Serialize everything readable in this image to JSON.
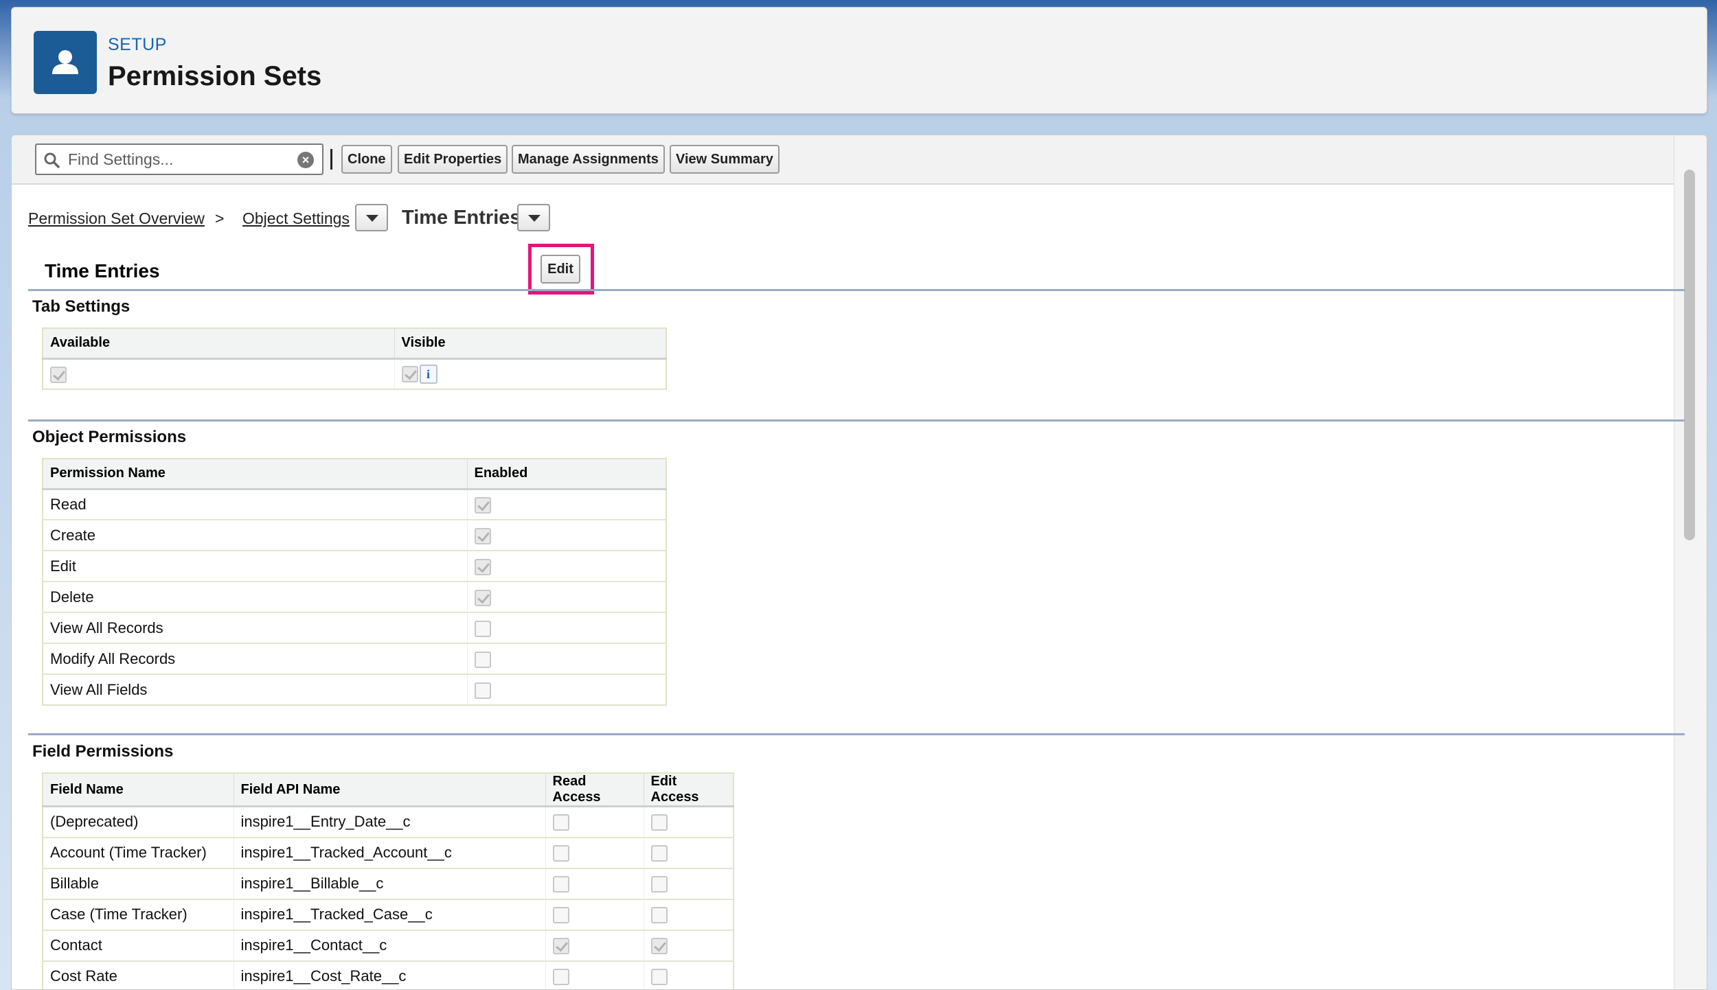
{
  "header": {
    "eyebrow": "SETUP",
    "title": "Permission Sets",
    "icon": "user-icon",
    "icon_color": "#1b5b96"
  },
  "toolbar": {
    "search_placeholder": "Find Settings...",
    "buttons": [
      "Clone",
      "Edit Properties",
      "Manage Assignments",
      "View Summary"
    ]
  },
  "breadcrumb": {
    "overview": "Permission Set Overview",
    "sep": ">",
    "object_settings": "Object Settings",
    "current": "Time Entries"
  },
  "object": {
    "title": "Time Entries",
    "edit_label": "Edit",
    "highlight_color": "#e3157a"
  },
  "tab_settings": {
    "title": "Tab Settings",
    "headers": [
      "Available",
      "Visible"
    ],
    "available": true,
    "visible": true,
    "info_glyph": "i"
  },
  "object_permissions": {
    "title": "Object Permissions",
    "headers": [
      "Permission Name",
      "Enabled"
    ],
    "rows": [
      {
        "name": "Read",
        "enabled": true
      },
      {
        "name": "Create",
        "enabled": true
      },
      {
        "name": "Edit",
        "enabled": true
      },
      {
        "name": "Delete",
        "enabled": true
      },
      {
        "name": "View All Records",
        "enabled": false
      },
      {
        "name": "Modify All Records",
        "enabled": false
      },
      {
        "name": "View All Fields",
        "enabled": false
      }
    ]
  },
  "field_permissions": {
    "title": "Field Permissions",
    "headers": [
      "Field Name",
      "Field API Name",
      "Read Access",
      "Edit Access"
    ],
    "rows": [
      {
        "name": "(Deprecated)",
        "api": "inspire1__Entry_Date__c",
        "read": false,
        "edit": false
      },
      {
        "name": "Account (Time Tracker)",
        "api": "inspire1__Tracked_Account__c",
        "read": false,
        "edit": false
      },
      {
        "name": "Billable",
        "api": "inspire1__Billable__c",
        "read": false,
        "edit": false
      },
      {
        "name": "Case (Time Tracker)",
        "api": "inspire1__Tracked_Case__c",
        "read": false,
        "edit": false
      },
      {
        "name": "Contact",
        "api": "inspire1__Contact__c",
        "read": true,
        "edit": true
      },
      {
        "name": "Cost Rate",
        "api": "inspire1__Cost_Rate__c",
        "read": false,
        "edit": false
      }
    ]
  }
}
